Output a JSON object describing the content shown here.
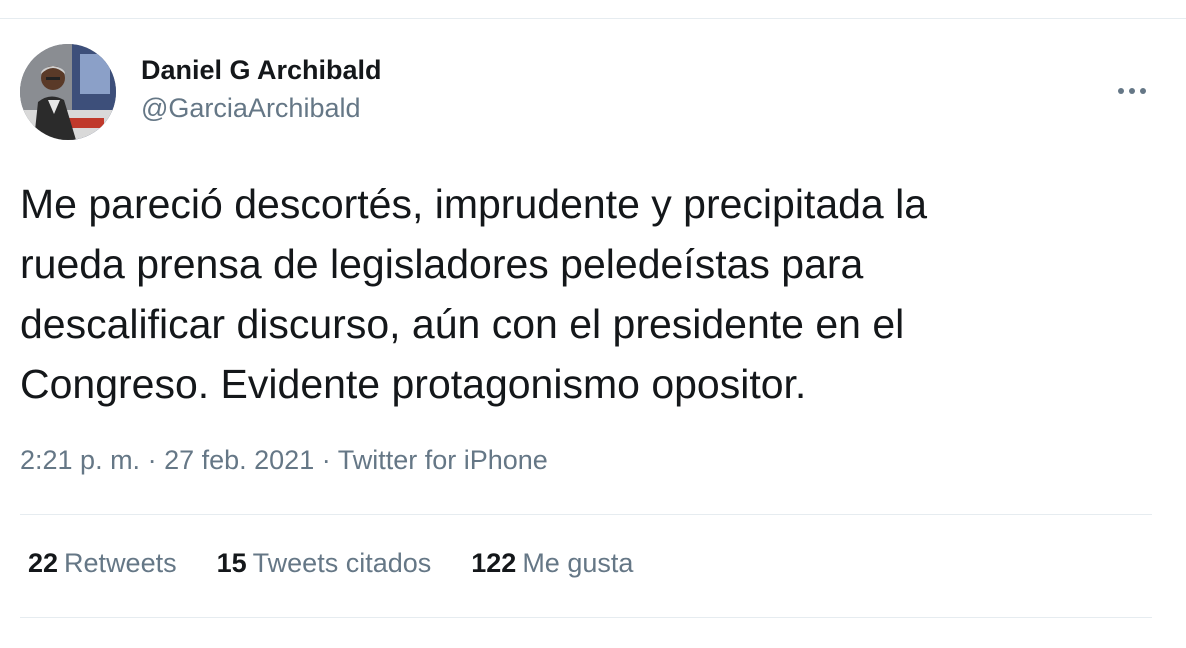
{
  "author": {
    "name": "Daniel G Archibald",
    "handle": "@GarciaArchibald"
  },
  "tweet": {
    "lines": [
      "Me pareció descortés, imprudente y precipitada la",
      "rueda prensa de legisladores peledeístas para",
      "descalificar discurso, aún con el presidente en el",
      "Congreso. Evidente protagonismo opositor."
    ]
  },
  "meta": {
    "time": "2:21 p. m.",
    "separator": " · ",
    "date": "27 feb. 2021",
    "source": "Twitter for iPhone"
  },
  "stats": {
    "retweets_count": "22",
    "retweets_label": "Retweets",
    "quotes_count": "15",
    "quotes_label": "Tweets citados",
    "likes_count": "122",
    "likes_label": "Me gusta"
  },
  "icons": {
    "more": "more-options-icon"
  },
  "colors": {
    "text_primary": "#14171a",
    "text_secondary": "#657786",
    "divider": "#e6ecf0"
  }
}
